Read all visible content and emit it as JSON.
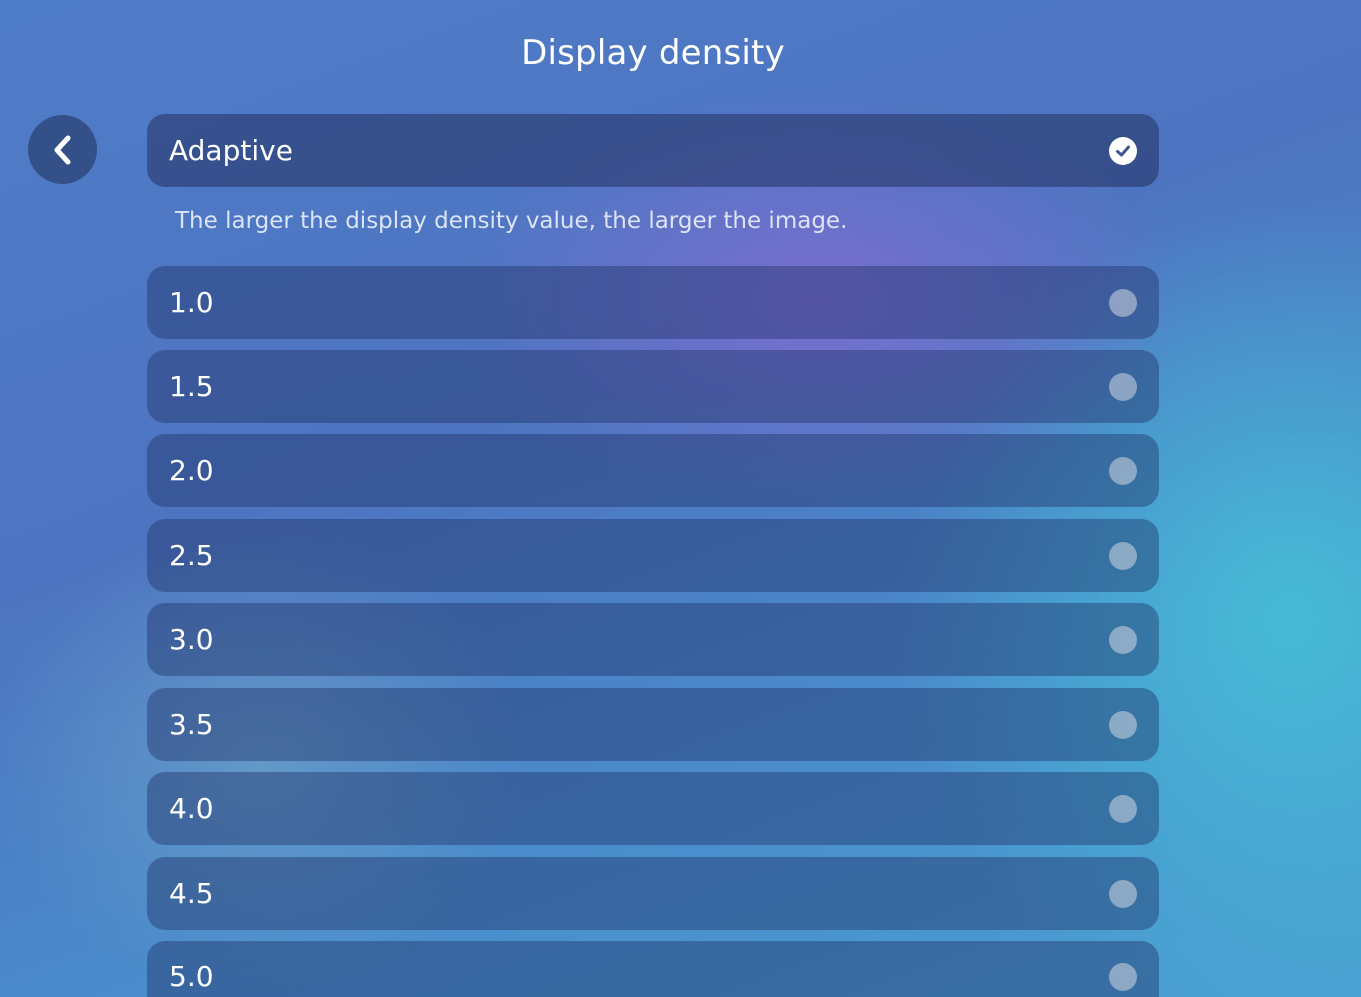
{
  "header": {
    "title": "Display density"
  },
  "back_button": {
    "icon": "chevron-left-icon"
  },
  "adaptive_option": {
    "label": "Adaptive",
    "selected": true,
    "icon": "check-circle-icon"
  },
  "description": "The larger the display density value, the larger the image.",
  "density_options": [
    {
      "label": "1.0",
      "selected": false
    },
    {
      "label": "1.5",
      "selected": false
    },
    {
      "label": "2.0",
      "selected": false
    },
    {
      "label": "2.5",
      "selected": false
    },
    {
      "label": "3.0",
      "selected": false
    },
    {
      "label": "3.5",
      "selected": false
    },
    {
      "label": "4.0",
      "selected": false
    },
    {
      "label": "4.5",
      "selected": false
    },
    {
      "label": "5.0",
      "selected": false
    }
  ],
  "colors": {
    "row_background": "#1e3064",
    "radio_unselected": "#d2d7e1",
    "check_fill": "#ffffff",
    "check_mark": "#3d5590"
  }
}
